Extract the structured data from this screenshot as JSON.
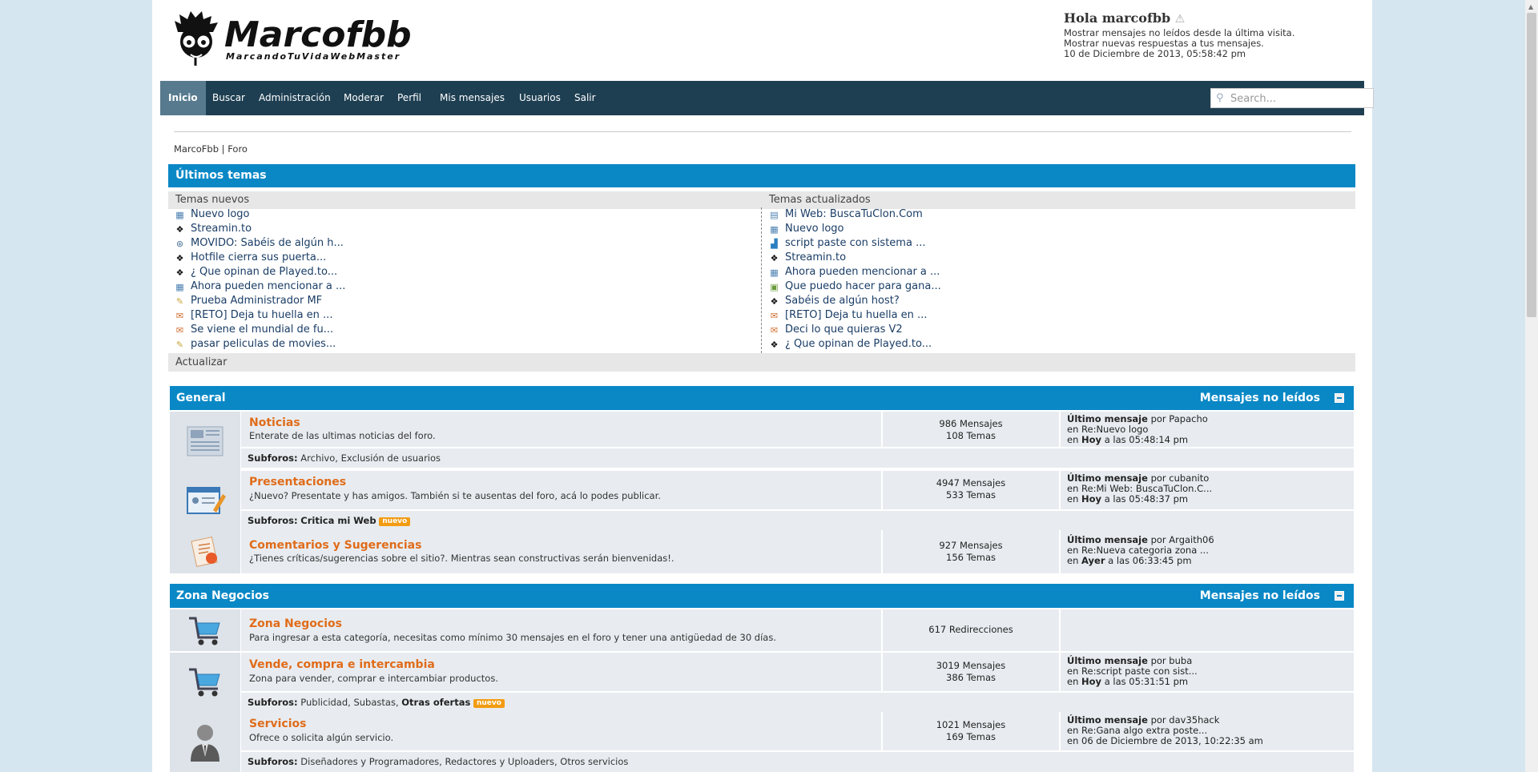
{
  "header": {
    "logo_title": "Marcofbb",
    "logo_subtitle": "MarcandoTuVidaWebMaster",
    "greeting": "Hola marcofbb",
    "links": [
      "Mostrar mensajes no leídos desde la última visita.",
      "Mostrar nuevas respuestas a tus mensajes.",
      "10 de Diciembre de 2013, 05:58:42 pm"
    ]
  },
  "nav": {
    "items": [
      "Inicio",
      "Buscar",
      "Administración",
      "Moderar",
      "Perfil",
      "Mis mensajes",
      "Usuarios",
      "Salir"
    ],
    "search_placeholder": "Search..."
  },
  "breadcrumb": "MarcoFbb | Foro",
  "recent": {
    "title": "Últimos temas",
    "new_header": "Temas nuevos",
    "updated_header": "Temas actualizados",
    "new_topics": [
      "Nuevo logo",
      "Streamin.to",
      "MOVIDO: Sabéis de algún h...",
      "Hotfile cierra sus puerta...",
      "¿ Que opinan de Played.to...",
      "Ahora pueden mencionar a ...",
      "Prueba Administrador MF",
      "[RETO] Deja tu huella en ...",
      "Se viene el mundial de fu...",
      "pasar peliculas de movies..."
    ],
    "updated_topics": [
      "Mi Web: BuscaTuClon.Com",
      "Nuevo logo",
      "script paste con sistema ...",
      "Streamin.to",
      "Ahora pueden mencionar a ...",
      "Que puedo hacer para gana...",
      "Sabéis de algún host?",
      "[RETO] Deja tu huella en ...",
      "Deci lo que quieras V2",
      "¿ Que opinan de Played.to..."
    ],
    "refresh": "Actualizar"
  },
  "categories": [
    {
      "name": "General",
      "unread": "Mensajes no leídos",
      "forums": [
        {
          "title": "Noticias",
          "desc": "Enterate de las ultimas noticias del foro.",
          "stats1": "986 Mensajes",
          "stats2": "108 Temas",
          "last1_bold": "Último mensaje",
          "last1_rest": " por Papacho",
          "last2": "en Re:Nuevo logo",
          "last3_bold": "Hoy",
          "last3_rest": " a las 05:48:14 pm",
          "subforos_label": "Subforos:",
          "subforos": "Archivo, Exclusión de usuarios"
        },
        {
          "title": "Presentaciones",
          "desc": "¿Nuevo? Presentate y has amigos. También si te ausentas del foro, acá lo podes publicar.",
          "stats1": "4947 Mensajes",
          "stats2": "533 Temas",
          "last1_bold": "Último mensaje",
          "last1_rest": " por cubanito",
          "last2": "en Re:Mi Web: BuscaTuClon.C...",
          "last3_bold": "Hoy",
          "last3_rest": " a las 05:48:37 pm",
          "subforos_label": "Subforos:",
          "subforos_bold": "Critica mi Web",
          "badge": "nuevo"
        },
        {
          "title": "Comentarios y Sugerencias",
          "desc": "¿Tienes críticas/sugerencias sobre el sitio?. Mientras sean constructivas serán bienvenidas!.",
          "stats1": "927 Mensajes",
          "stats2": "156 Temas",
          "last1_bold": "Último mensaje",
          "last1_rest": " por Argaith06",
          "last2": "en Re:Nueva categoria zona ...",
          "last3_bold": "Ayer",
          "last3_rest": " a las 06:33:45 pm"
        }
      ]
    },
    {
      "name": "Zona Negocios",
      "unread": "Mensajes no leídos",
      "forums": [
        {
          "title": "Zona Negocios",
          "desc": "Para ingresar a esta categoría, necesitas como mínimo 30 mensajes en el foro y tener una antigüedad de 30 días.",
          "stats1": "617 Redirecciones"
        },
        {
          "title": "Vende, compra e intercambia",
          "desc": "Zona para vender, comprar e intercambiar productos.",
          "stats1": "3019 Mensajes",
          "stats2": "386 Temas",
          "last1_bold": "Último mensaje",
          "last1_rest": " por buba",
          "last2": "en Re:script paste con sist...",
          "last3_bold": "Hoy",
          "last3_rest": " a las 05:31:51 pm",
          "subforos_label": "Subforos:",
          "subforos": "Publicidad, Subastas, ",
          "subforos_bold": "Otras ofertas",
          "badge": "nuevo"
        },
        {
          "title": "Servicios",
          "desc": "Ofrece o solicita algún servicio.",
          "stats1": "1021 Mensajes",
          "stats2": "169 Temas",
          "last1_bold": "Último mensaje",
          "last1_rest": " por dav35hack",
          "last2": "en Re:Gana algo extra poste...",
          "last3": "en 06 de Diciembre de 2013, 10:22:35 am",
          "subforos_label": "Subforos:",
          "subforos": "Diseñadores y Programadores, Redactores y Uploaders, Otros servicios"
        }
      ]
    }
  ]
}
